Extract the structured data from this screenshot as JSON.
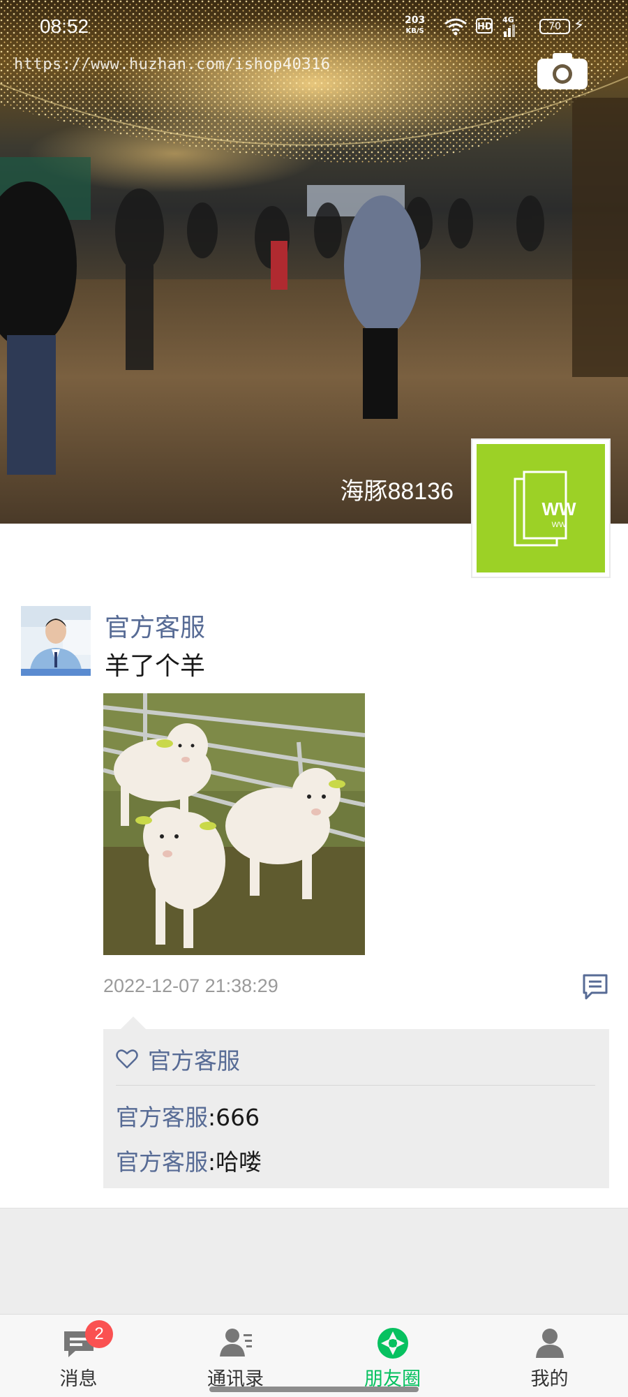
{
  "status_bar": {
    "time": "08:52",
    "net_speed_value": "203",
    "net_speed_unit": "KB/S",
    "hd": "HD",
    "signal": "4G",
    "battery": "70"
  },
  "watermark": "https://www.huzhan.com/ishop40316",
  "cover": {
    "nickname": "海豚88136",
    "avatar_text": "WW",
    "avatar_subtext": "WW"
  },
  "post": {
    "author": "官方客服",
    "text": "羊了个羊",
    "time": "2022-12-07 21:38:29",
    "likes": [
      "官方客服"
    ],
    "comments": [
      {
        "author": "官方客服",
        "text": ":666"
      },
      {
        "author": "官方客服",
        "text": ":哈喽"
      }
    ]
  },
  "tabs": [
    {
      "label": "消息",
      "icon": "chat-icon",
      "badge": "2"
    },
    {
      "label": "通讯录",
      "icon": "contacts-icon"
    },
    {
      "label": "朋友圈",
      "icon": "moments-icon",
      "active": true
    },
    {
      "label": "我的",
      "icon": "profile-icon"
    }
  ],
  "colors": {
    "link_blue": "#576b95",
    "active_green": "#07c160",
    "badge_red": "#fa5151",
    "avatar_green": "#9cd126"
  }
}
